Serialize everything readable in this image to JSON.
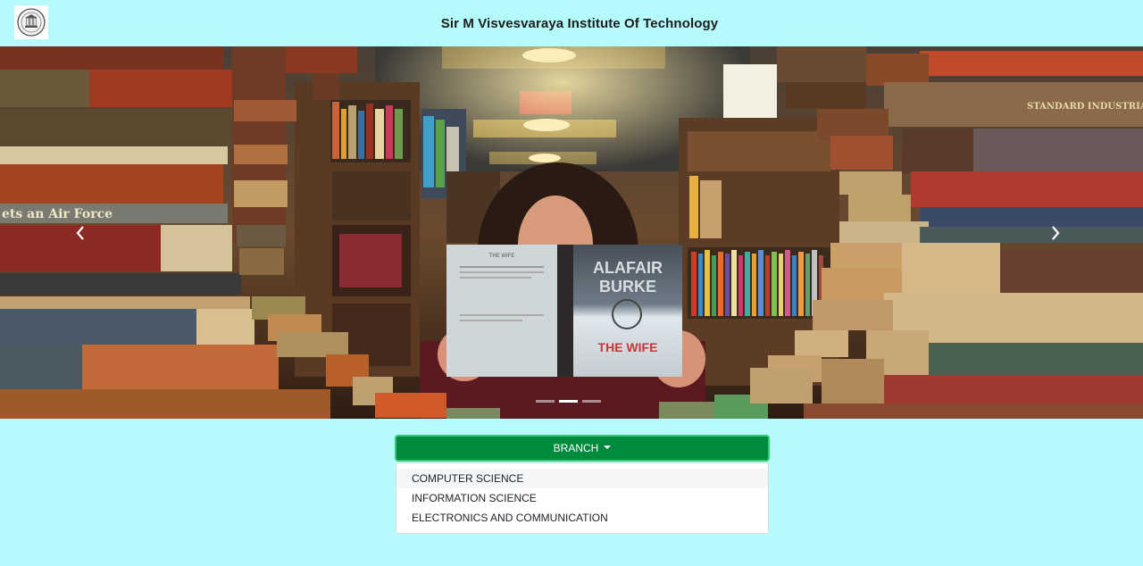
{
  "header": {
    "title": "Sir M Visvesvaraya Institute Of Technology",
    "logo_icon": "college-emblem-icon"
  },
  "carousel": {
    "slides": 3,
    "active_slide": 2,
    "prev_icon": "chevron-left-icon",
    "next_icon": "chevron-right-icon",
    "book_cover": {
      "author_first": "ALAFAIR",
      "author_last": "BURKE",
      "title": "THE WIFE",
      "spine": "THE WIFE  ALAFAIR BURKE",
      "back_title": "THE WIFE"
    },
    "spine_texts": {
      "left_spine": "ets an Air Force",
      "right_spine": "STANDARD INDUSTRIAL CLASS"
    }
  },
  "dropdown": {
    "label": "BRANCH",
    "caret_icon": "caret-down-icon",
    "accent": "#008a3e",
    "items": [
      {
        "label": "COMPUTER SCIENCE"
      },
      {
        "label": "INFORMATION SCIENCE"
      },
      {
        "label": "ELECTRONICS AND COMMUNICATION"
      }
    ]
  },
  "colors": {
    "page_background": "#b6fbfb",
    "button": "#008a3e"
  }
}
